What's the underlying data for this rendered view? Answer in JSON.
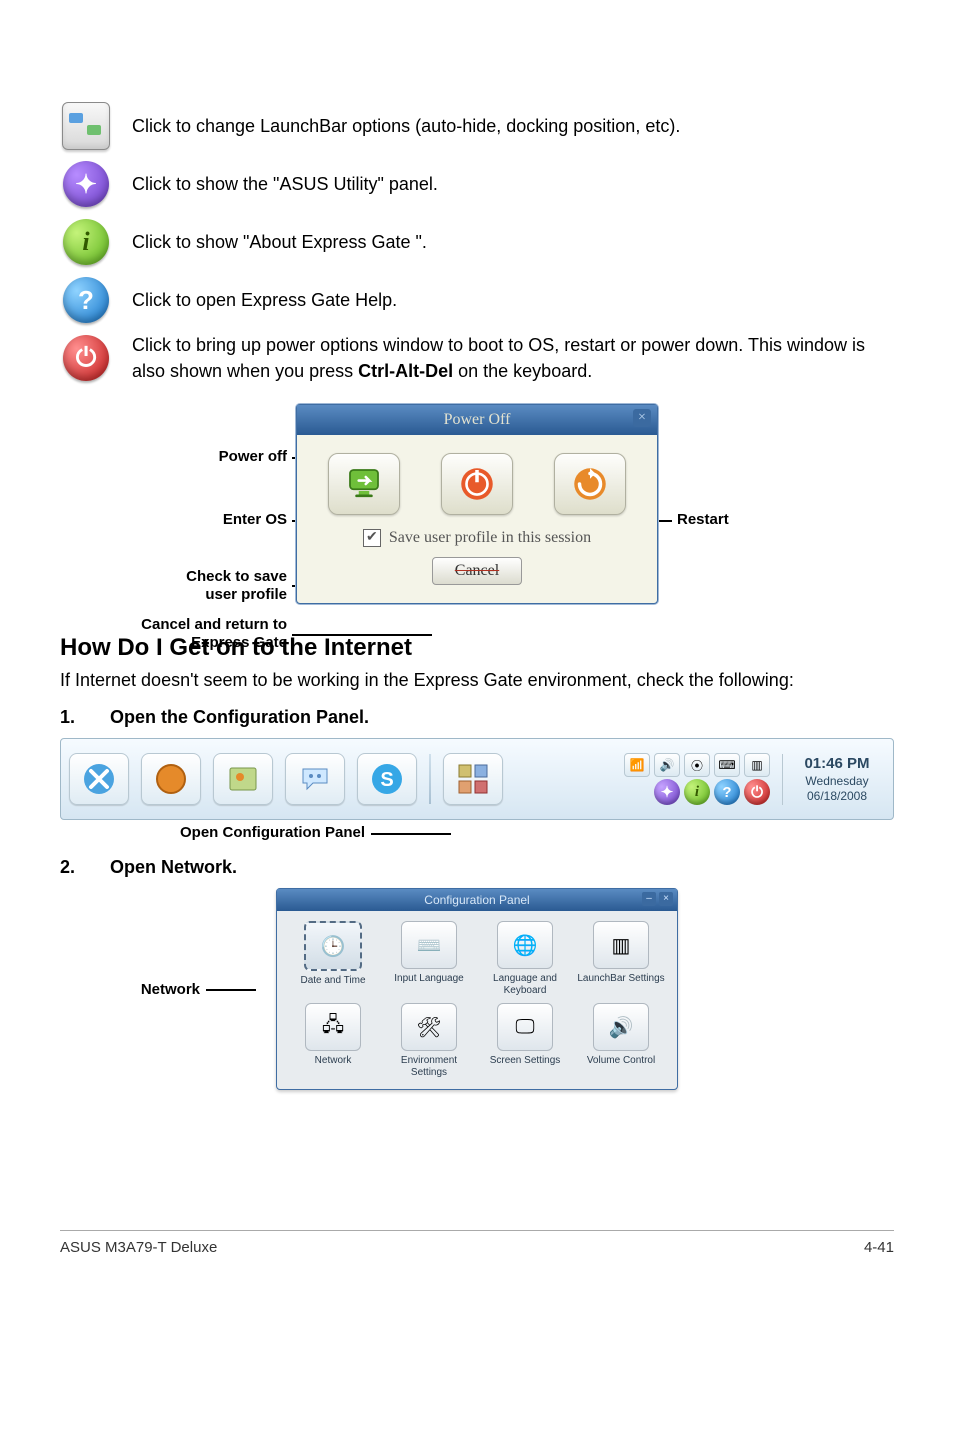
{
  "launchbar_items": [
    {
      "type": "square",
      "name": "launchbar-options-icon",
      "desc": "Click to change LaunchBar options (auto-hide, docking position, etc)."
    },
    {
      "type": "violet",
      "glyph": "✦",
      "name": "asus-utility-icon",
      "desc": "Click to show the \"ASUS Utility\" panel."
    },
    {
      "type": "green",
      "glyph": "i",
      "name": "about-icon",
      "desc": "Click to show \"About Express Gate \"."
    },
    {
      "type": "blue",
      "glyph": "?",
      "name": "help-icon",
      "desc": "Click to open Express Gate  Help."
    },
    {
      "type": "red",
      "glyph": "⏻",
      "name": "power-icon",
      "desc": "Click to bring up power options window to boot to OS, restart or power down. This window is also shown when you press Ctrl-Alt-Del on the keyboard.",
      "bold_at": "Ctrl-Alt-Del"
    }
  ],
  "power_dialog": {
    "title": "Power Off",
    "labels": {
      "power_off": "Power off",
      "enter_os": "Enter OS",
      "restart": "Restart",
      "save_profile": "Check to save user profile",
      "cancel_return": "Cancel and return to Express Gate"
    },
    "checkbox_text": "Save user profile in this session",
    "cancel_button": "Cancel"
  },
  "section_title": "How Do I Get on to the Internet",
  "section_lead": "If Internet doesn't seem to be working in the Express Gate  environment, check the following:",
  "steps": {
    "1": "Open the Configuration Panel.",
    "2": "Open Network."
  },
  "taskbar": {
    "caption": "Open Configuration Panel",
    "clock": {
      "time": "01:46 PM",
      "day": "Wednesday",
      "date": "06/18/2008"
    }
  },
  "config_panel": {
    "title": "Configuration Panel",
    "network_label": "Network",
    "items": [
      {
        "label": "Date and Time",
        "name": "date-and-time-icon",
        "selected": true
      },
      {
        "label": "Input Language",
        "name": "input-language-icon"
      },
      {
        "label": "Language and Keyboard",
        "name": "language-keyboard-icon"
      },
      {
        "label": "LaunchBar Settings",
        "name": "launchbar-settings-icon"
      },
      {
        "label": "Network",
        "name": "network-icon"
      },
      {
        "label": "Environment Settings",
        "name": "environment-settings-icon"
      },
      {
        "label": "Screen Settings",
        "name": "screen-settings-icon"
      },
      {
        "label": "Volume Control",
        "name": "volume-control-icon"
      }
    ]
  },
  "footer": {
    "left": "ASUS M3A79-T Deluxe",
    "right": "4-41"
  }
}
